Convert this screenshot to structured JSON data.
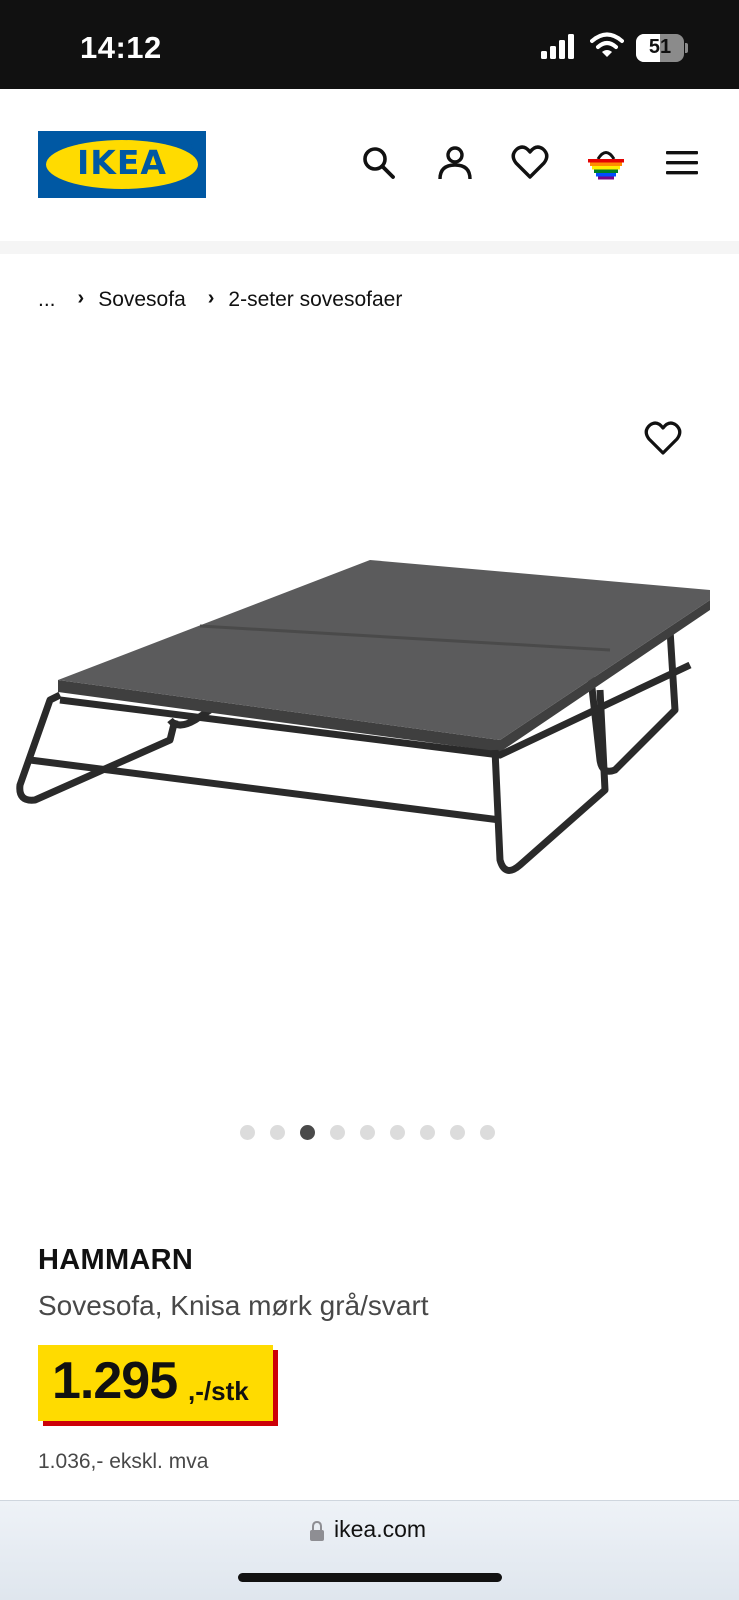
{
  "status_bar": {
    "time": "14:12",
    "battery": "51",
    "battery_level_percent": 51
  },
  "header": {
    "logo_text": "IKEA",
    "icons": [
      "search-icon",
      "account-icon",
      "heart-icon",
      "basket-icon",
      "menu-icon"
    ]
  },
  "breadcrumb": {
    "ellipsis": "...",
    "items": [
      "Sovesofa",
      "2-seter sovesofaer"
    ]
  },
  "gallery": {
    "dot_count": 9,
    "active_index": 2
  },
  "product": {
    "name": "HAMMARN",
    "description": "Sovesofa, Knisa mørk grå/svart",
    "price": "1.295",
    "price_unit": ",-/stk",
    "price_ex_vat": "1.036,- ekskl. mva"
  },
  "browser": {
    "url": "ikea.com"
  },
  "colors": {
    "brand_blue": "#0058a3",
    "brand_yellow": "#ffdb00",
    "price_shadow": "#cc0008"
  }
}
